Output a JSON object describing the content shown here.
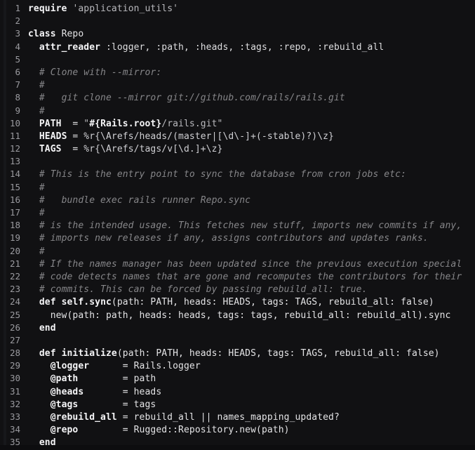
{
  "editor": {
    "name": "code-viewer",
    "language": "Ruby",
    "theme": "dark",
    "background_color": "#111113",
    "gutter_strip_color": "#17181b",
    "line_number_color": "#9a9a9f",
    "text_color": "#e8e8ea",
    "comment_color": "#868689",
    "string_color": "#b9b9bd",
    "first_line": 1,
    "last_line": 35,
    "total_lines": 35
  },
  "lines": [
    {
      "number": "1",
      "tokens": [
        {
          "t": "require",
          "c": "kw"
        },
        {
          "t": " ",
          "c": "plain"
        },
        {
          "t": "'application_utils'",
          "c": "str"
        }
      ]
    },
    {
      "number": "2",
      "tokens": []
    },
    {
      "number": "3",
      "tokens": [
        {
          "t": "class",
          "c": "kw"
        },
        {
          "t": " Repo",
          "c": "plain"
        }
      ]
    },
    {
      "number": "4",
      "tokens": [
        {
          "t": "  ",
          "c": "plain"
        },
        {
          "t": "attr_reader",
          "c": "kw"
        },
        {
          "t": " ",
          "c": "plain"
        },
        {
          "t": ":logger, :path, :heads, :tags, :repo, :rebuild_all",
          "c": "sym"
        }
      ]
    },
    {
      "number": "5",
      "tokens": []
    },
    {
      "number": "6",
      "tokens": [
        {
          "t": "  ",
          "c": "plain"
        },
        {
          "t": "# Clone with --mirror:",
          "c": "comment"
        }
      ]
    },
    {
      "number": "7",
      "tokens": [
        {
          "t": "  ",
          "c": "plain"
        },
        {
          "t": "#",
          "c": "comment"
        }
      ]
    },
    {
      "number": "8",
      "tokens": [
        {
          "t": "  ",
          "c": "plain"
        },
        {
          "t": "#   git clone --mirror git://github.com/rails/rails.git",
          "c": "comment"
        }
      ]
    },
    {
      "number": "9",
      "tokens": [
        {
          "t": "  ",
          "c": "plain"
        },
        {
          "t": "#",
          "c": "comment"
        }
      ]
    },
    {
      "number": "10",
      "tokens": [
        {
          "t": "  ",
          "c": "plain"
        },
        {
          "t": "PATH",
          "c": "kw"
        },
        {
          "t": "  = ",
          "c": "plain"
        },
        {
          "t": "\"",
          "c": "str"
        },
        {
          "t": "#{Rails.root}",
          "c": "interp"
        },
        {
          "t": "/rails.git\"",
          "c": "str"
        }
      ]
    },
    {
      "number": "11",
      "tokens": [
        {
          "t": "  ",
          "c": "plain"
        },
        {
          "t": "HEADS",
          "c": "kw"
        },
        {
          "t": " = ",
          "c": "plain"
        },
        {
          "t": "%r{\\Arefs/heads/(master|[\\d\\-]+(-stable)?)\\z}",
          "c": "regex"
        }
      ]
    },
    {
      "number": "12",
      "tokens": [
        {
          "t": "  ",
          "c": "plain"
        },
        {
          "t": "TAGS",
          "c": "kw"
        },
        {
          "t": "  = ",
          "c": "plain"
        },
        {
          "t": "%r{\\Arefs/tags/v[\\d.]+\\z}",
          "c": "regex"
        }
      ]
    },
    {
      "number": "13",
      "tokens": []
    },
    {
      "number": "14",
      "tokens": [
        {
          "t": "  ",
          "c": "plain"
        },
        {
          "t": "# This is the entry point to sync the database from cron jobs etc:",
          "c": "comment"
        }
      ]
    },
    {
      "number": "15",
      "tokens": [
        {
          "t": "  ",
          "c": "plain"
        },
        {
          "t": "#",
          "c": "comment"
        }
      ]
    },
    {
      "number": "16",
      "tokens": [
        {
          "t": "  ",
          "c": "plain"
        },
        {
          "t": "#   bundle exec rails runner Repo.sync",
          "c": "comment"
        }
      ]
    },
    {
      "number": "17",
      "tokens": [
        {
          "t": "  ",
          "c": "plain"
        },
        {
          "t": "#",
          "c": "comment"
        }
      ]
    },
    {
      "number": "18",
      "tokens": [
        {
          "t": "  ",
          "c": "plain"
        },
        {
          "t": "# is the intended usage. This fetches new stuff, imports new commits if any,",
          "c": "comment"
        }
      ]
    },
    {
      "number": "19",
      "tokens": [
        {
          "t": "  ",
          "c": "plain"
        },
        {
          "t": "# imports new releases if any, assigns contributors and updates ranks.",
          "c": "comment"
        }
      ]
    },
    {
      "number": "20",
      "tokens": [
        {
          "t": "  ",
          "c": "plain"
        },
        {
          "t": "#",
          "c": "comment"
        }
      ]
    },
    {
      "number": "21",
      "tokens": [
        {
          "t": "  ",
          "c": "plain"
        },
        {
          "t": "# If the names manager has been updated since the previous execution special",
          "c": "comment"
        }
      ]
    },
    {
      "number": "22",
      "tokens": [
        {
          "t": "  ",
          "c": "plain"
        },
        {
          "t": "# code detects names that are gone and recomputes the contributors for their",
          "c": "comment"
        }
      ]
    },
    {
      "number": "23",
      "tokens": [
        {
          "t": "  ",
          "c": "plain"
        },
        {
          "t": "# commits. This can be forced by passing rebuild_all: true.",
          "c": "comment"
        }
      ]
    },
    {
      "number": "24",
      "tokens": [
        {
          "t": "  ",
          "c": "plain"
        },
        {
          "t": "def",
          "c": "kw"
        },
        {
          "t": " ",
          "c": "plain"
        },
        {
          "t": "self.sync",
          "c": "kw"
        },
        {
          "t": "(path: PATH, heads: HEADS, tags: TAGS, rebuild_all: false)",
          "c": "plain"
        }
      ]
    },
    {
      "number": "25",
      "tokens": [
        {
          "t": "    new(path: path, heads: heads, tags: tags, rebuild_all: rebuild_all).sync",
          "c": "plain"
        }
      ]
    },
    {
      "number": "26",
      "tokens": [
        {
          "t": "  ",
          "c": "plain"
        },
        {
          "t": "end",
          "c": "kw"
        }
      ]
    },
    {
      "number": "27",
      "tokens": []
    },
    {
      "number": "28",
      "tokens": [
        {
          "t": "  ",
          "c": "plain"
        },
        {
          "t": "def",
          "c": "kw"
        },
        {
          "t": " ",
          "c": "plain"
        },
        {
          "t": "initialize",
          "c": "kw"
        },
        {
          "t": "(path: PATH, heads: HEADS, tags: TAGS, rebuild_all: false)",
          "c": "plain"
        }
      ]
    },
    {
      "number": "29",
      "tokens": [
        {
          "t": "    ",
          "c": "plain"
        },
        {
          "t": "@logger",
          "c": "ivar"
        },
        {
          "t": "      = Rails.logger",
          "c": "plain"
        }
      ]
    },
    {
      "number": "30",
      "tokens": [
        {
          "t": "    ",
          "c": "plain"
        },
        {
          "t": "@path",
          "c": "ivar"
        },
        {
          "t": "        = path",
          "c": "plain"
        }
      ]
    },
    {
      "number": "31",
      "tokens": [
        {
          "t": "    ",
          "c": "plain"
        },
        {
          "t": "@heads",
          "c": "ivar"
        },
        {
          "t": "       = heads",
          "c": "plain"
        }
      ]
    },
    {
      "number": "32",
      "tokens": [
        {
          "t": "    ",
          "c": "plain"
        },
        {
          "t": "@tags",
          "c": "ivar"
        },
        {
          "t": "        = tags",
          "c": "plain"
        }
      ]
    },
    {
      "number": "33",
      "tokens": [
        {
          "t": "    ",
          "c": "plain"
        },
        {
          "t": "@rebuild_all",
          "c": "ivar"
        },
        {
          "t": " = rebuild_all || names_mapping_updated?",
          "c": "plain"
        }
      ]
    },
    {
      "number": "34",
      "tokens": [
        {
          "t": "    ",
          "c": "plain"
        },
        {
          "t": "@repo",
          "c": "ivar"
        },
        {
          "t": "        = Rugged::Repository.new(path)",
          "c": "plain"
        }
      ]
    },
    {
      "number": "35",
      "tokens": [
        {
          "t": "  ",
          "c": "plain"
        },
        {
          "t": "end",
          "c": "kw"
        }
      ]
    }
  ]
}
